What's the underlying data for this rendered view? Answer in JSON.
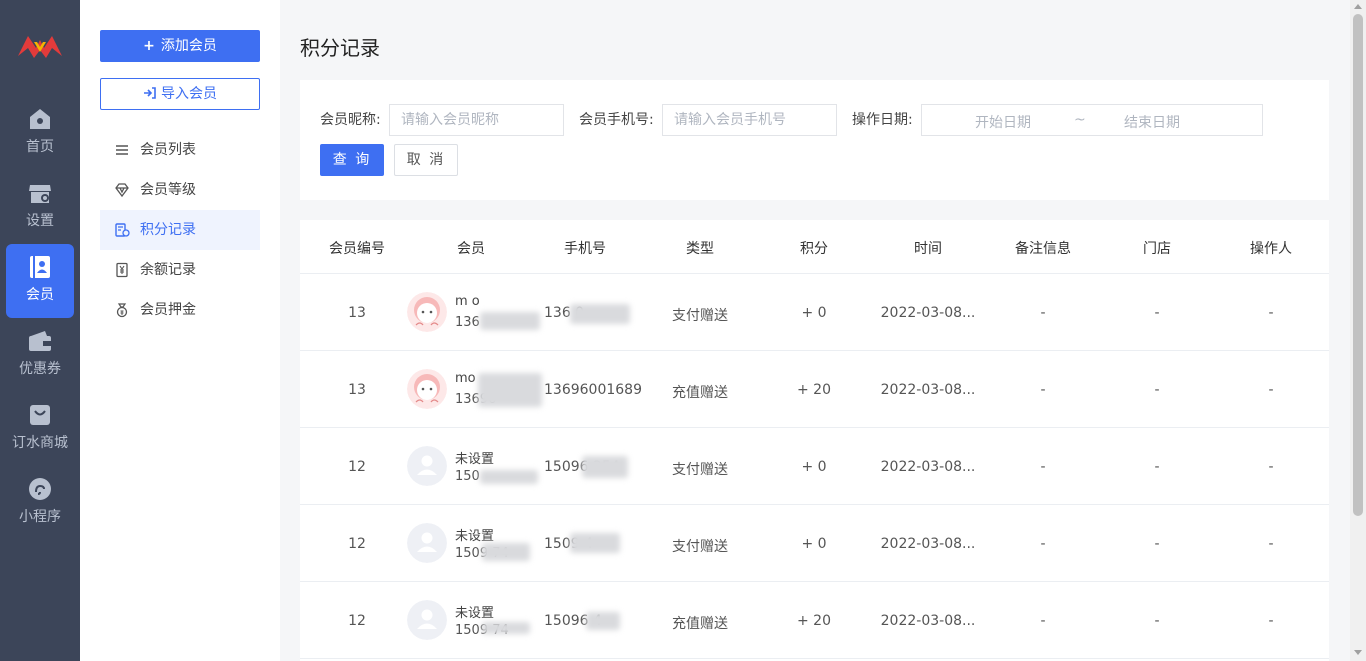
{
  "rail": {
    "items": [
      {
        "label": "首页",
        "icon": "home-icon"
      },
      {
        "label": "设置",
        "icon": "store-settings-icon"
      },
      {
        "label": "会员",
        "icon": "member-card-icon",
        "active": true
      },
      {
        "label": "优惠券",
        "icon": "wallet-icon"
      },
      {
        "label": "订水商城",
        "icon": "shopping-bag-icon"
      },
      {
        "label": "小程序",
        "icon": "miniprogram-icon"
      }
    ]
  },
  "subnav": {
    "add_label": "添加会员",
    "import_label": "导入会员",
    "items": [
      {
        "label": "会员列表",
        "icon": "list-icon"
      },
      {
        "label": "会员等级",
        "icon": "diamond-icon"
      },
      {
        "label": "积分记录",
        "icon": "points-record-icon",
        "active": true
      },
      {
        "label": "余额记录",
        "icon": "yen-record-icon"
      },
      {
        "label": "会员押金",
        "icon": "deposit-bag-icon"
      }
    ]
  },
  "page": {
    "title": "积分记录"
  },
  "filter": {
    "nickname_label": "会员昵称:",
    "nickname_placeholder": "请输入会员昵称",
    "phone_label": "会员手机号:",
    "phone_placeholder": "请输入会员手机号",
    "date_label": "操作日期:",
    "start_placeholder": "开始日期",
    "range_sep": "~",
    "end_placeholder": "结束日期",
    "query_label": "查 询",
    "cancel_label": "取 消"
  },
  "table": {
    "columns": [
      "会员编号",
      "会员",
      "手机号",
      "类型",
      "积分",
      "时间",
      "备注信息",
      "门店",
      "操作人"
    ],
    "rows": [
      {
        "id": "13",
        "name": "m   o",
        "member_phone": "136",
        "phone": "136   0    ",
        "type": "支付赠送",
        "points": "+ 0",
        "time": "2022-03-08...",
        "note": "-",
        "store": "-",
        "operator": "-",
        "avatar": "cartoon"
      },
      {
        "id": "13",
        "name": "mo",
        "member_phone": "13696",
        "phone": "13696001689",
        "type": "充值赠送",
        "points": "+ 20",
        "time": "2022-03-08...",
        "note": "-",
        "store": "-",
        "operator": "-",
        "avatar": "cartoon"
      },
      {
        "id": "12",
        "name": "未设置",
        "member_phone": "150",
        "phone": "15096    254",
        "type": "支付赠送",
        "points": "+ 0",
        "time": "2022-03-08...",
        "note": "-",
        "store": "-",
        "operator": "-",
        "avatar": "default"
      },
      {
        "id": "12",
        "name": "未设置",
        "member_phone": "1509       74",
        "phone": "1509      4",
        "type": "支付赠送",
        "points": "+ 0",
        "time": "2022-03-08...",
        "note": "-",
        "store": "-",
        "operator": "-",
        "avatar": "default"
      },
      {
        "id": "12",
        "name": "未设置",
        "member_phone": "1509       74",
        "phone": "15096      4",
        "type": "充值赠送",
        "points": "+ 20",
        "time": "2022-03-08...",
        "note": "-",
        "store": "-",
        "operator": "-",
        "avatar": "default"
      }
    ]
  },
  "colors": {
    "accent": "#3e6ff2",
    "rail_bg": "#3c4559",
    "page_bg": "#f5f6f8"
  }
}
